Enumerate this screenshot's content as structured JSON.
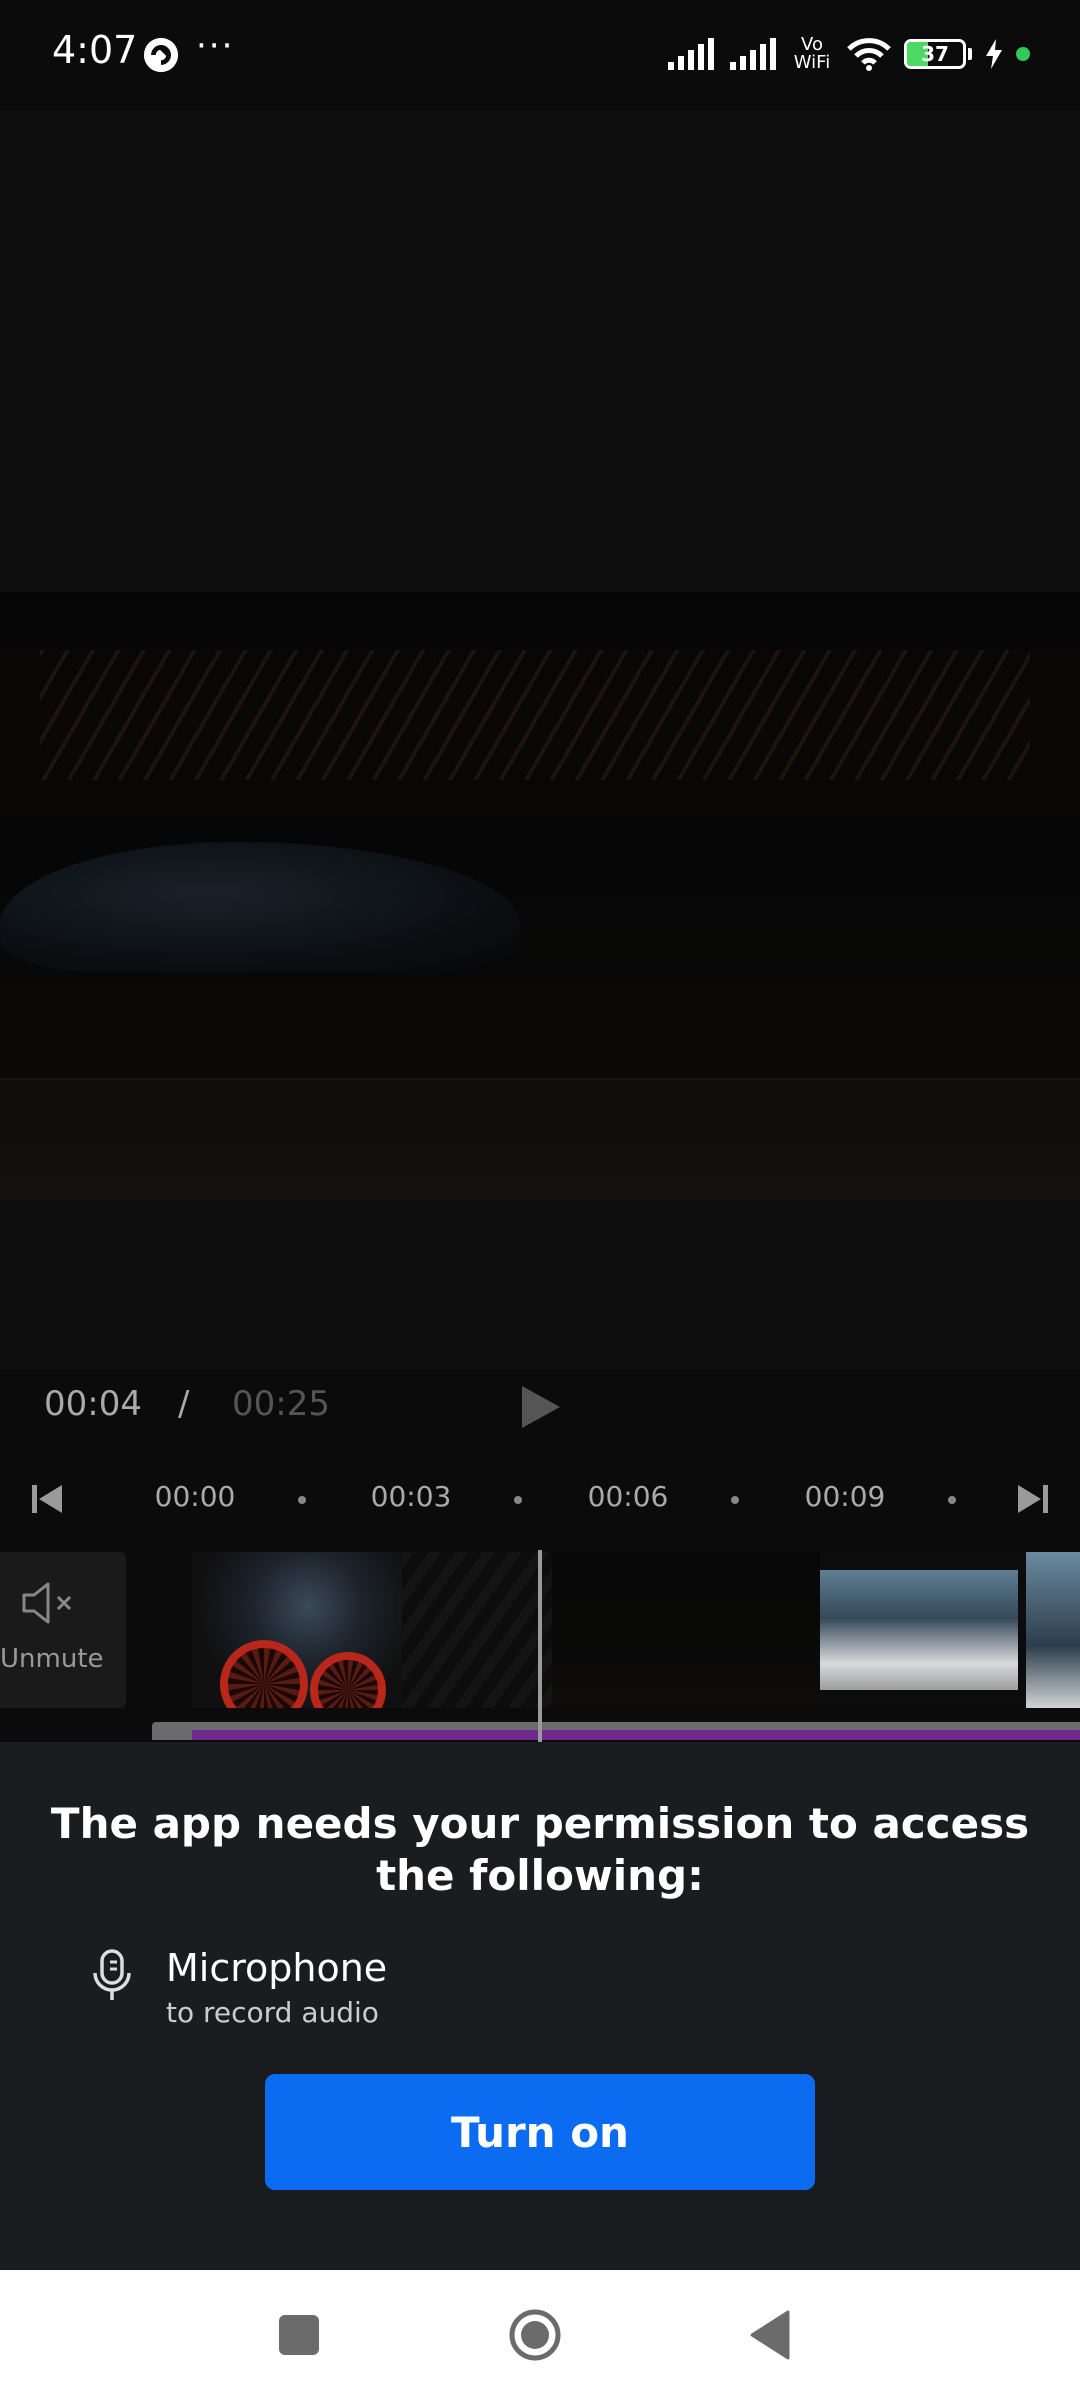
{
  "status_bar": {
    "time": "4:07",
    "dots": "···",
    "vowifi_top": "Vo",
    "vowifi_bottom": "WiFi",
    "battery_level": "37",
    "battery_fraction": 0.37
  },
  "player": {
    "current_time": "00:04",
    "separator": "/",
    "total_time": "00:25"
  },
  "ruler": {
    "labels": [
      "00:00",
      "00:03",
      "00:06",
      "00:09"
    ]
  },
  "timeline": {
    "unmute_label": "Unmute"
  },
  "permission": {
    "title": "The app needs your permission to access the following:",
    "item_name": "Microphone",
    "item_desc": "to record audio",
    "button_label": "Turn on"
  },
  "colors": {
    "accent_button": "#0b6cf2",
    "audio_track": "#6e2a8c",
    "sheet_bg": "#1b1c1f"
  },
  "icons": {
    "status_app": "custom-app-icon",
    "signal": "signal-bars-icon",
    "wifi": "wifi-icon",
    "battery": "battery-icon",
    "charging": "lightning-icon",
    "play": "play-icon",
    "skip_start": "skip-to-start-icon",
    "skip_end": "skip-to-end-icon",
    "mute": "speaker-muted-icon",
    "microphone": "microphone-icon",
    "nav_recents": "square-icon",
    "nav_home": "circle-icon",
    "nav_back": "triangle-back-icon"
  }
}
